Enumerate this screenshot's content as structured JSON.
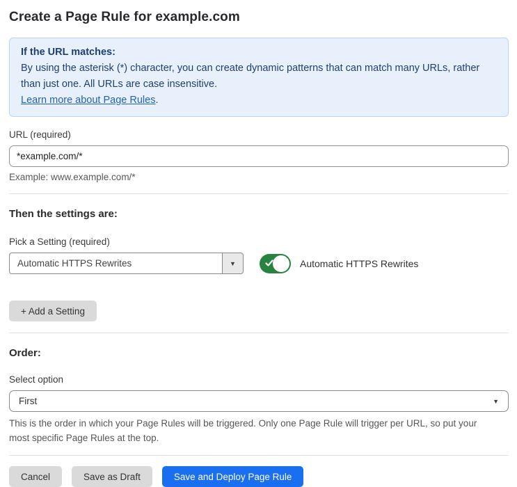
{
  "page": {
    "title": "Create a Page Rule for example.com"
  },
  "info_box": {
    "heading": "If the URL matches:",
    "body": "By using the asterisk (*) character, you can create dynamic patterns that can match many URLs, rather than just one. All URLs are case insensitive.",
    "link_label": "Learn more about Page Rules",
    "link_suffix": "."
  },
  "url_section": {
    "label": "URL (required)",
    "value": "*example.com/*",
    "example": "Example: www.example.com/*"
  },
  "settings_section": {
    "heading": "Then the settings are:",
    "pick_label": "Pick a Setting (required)",
    "selected_setting": "Automatic HTTPS Rewrites",
    "dropdown_caret": "▼",
    "toggle_state": "on",
    "toggle_label": "Automatic HTTPS Rewrites",
    "add_button_label": "+ Add a Setting"
  },
  "order_section": {
    "heading": "Order:",
    "select_label": "Select option",
    "selected_option": "First",
    "dropdown_caret": "▼",
    "help": "This is the order in which your Page Rules will be triggered. Only one Page Rule will trigger per URL, so put your most specific Page Rules at the top."
  },
  "footer": {
    "cancel_label": "Cancel",
    "save_draft_label": "Save as Draft",
    "deploy_label": "Save and Deploy Page Rule"
  },
  "colors": {
    "accent_blue": "#1a6ef0",
    "toggle_green": "#27833f",
    "info_bg": "#e8f1fb",
    "info_border": "#b9d6f2",
    "info_text": "#1d3f72",
    "link_blue": "#2362b2"
  }
}
